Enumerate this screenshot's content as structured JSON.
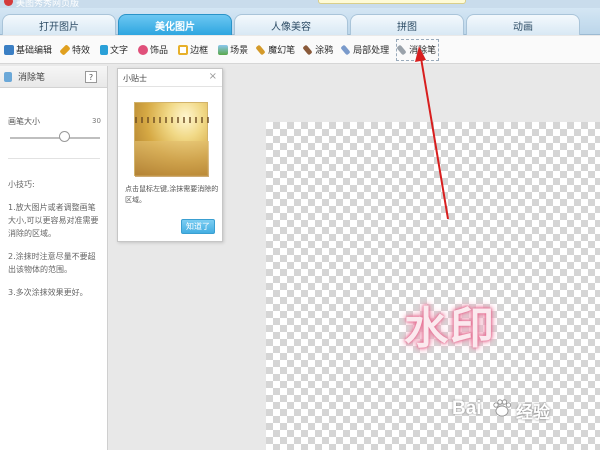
{
  "window": {
    "title": "美图秀秀网页版"
  },
  "tabs": [
    {
      "label": "打开图片",
      "active": false
    },
    {
      "label": "美化图片",
      "active": true
    },
    {
      "label": "人像美容",
      "active": false
    },
    {
      "label": "拼图",
      "active": false
    },
    {
      "label": "动画",
      "active": false
    }
  ],
  "toolbar": {
    "items": [
      {
        "label": "基础编辑",
        "icon": "image-icon",
        "color": "#3b7fc4"
      },
      {
        "label": "特效",
        "icon": "magic-wand-icon",
        "color": "#e0a020"
      },
      {
        "label": "文字",
        "icon": "text-icon",
        "color": "#2aa0d8"
      },
      {
        "label": "饰品",
        "icon": "bow-icon",
        "color": "#e0507a"
      },
      {
        "label": "边框",
        "icon": "frame-icon",
        "color": "#e7b02a"
      },
      {
        "label": "场景",
        "icon": "scene-icon",
        "color": "#5aa84a"
      },
      {
        "label": "魔幻笔",
        "icon": "pen-icon",
        "color": "#d49a2a"
      },
      {
        "label": "涂鸦",
        "icon": "brush-icon",
        "color": "#8a5a3a"
      },
      {
        "label": "局部处理",
        "icon": "local-edit-icon",
        "color": "#7a9acb"
      },
      {
        "label": "消除笔",
        "icon": "eraser-pen-icon",
        "color": "#9aa2aa"
      }
    ]
  },
  "left_panel": {
    "title": "消除笔",
    "help": "?",
    "brush_size_label": "画笔大小",
    "brush_size_value": "30",
    "brush_size_fraction": 0.6,
    "tips_title": "小技巧:",
    "tips": [
      "1.放大图片或者调整画笔大小,可以更容易对准需要消除的区域。",
      "2.涂抹时注意尽量不要超出该物体的范围。",
      "3.多次涂抹效果更好。"
    ]
  },
  "tip_popup": {
    "title": "小贴士",
    "close": "×",
    "text": "点击鼠标左键,涂抹需要消除的区域。",
    "button": "知道了"
  },
  "canvas": {
    "watermark": "水印"
  },
  "logo": {
    "left": "Bai",
    "right": "经验"
  }
}
